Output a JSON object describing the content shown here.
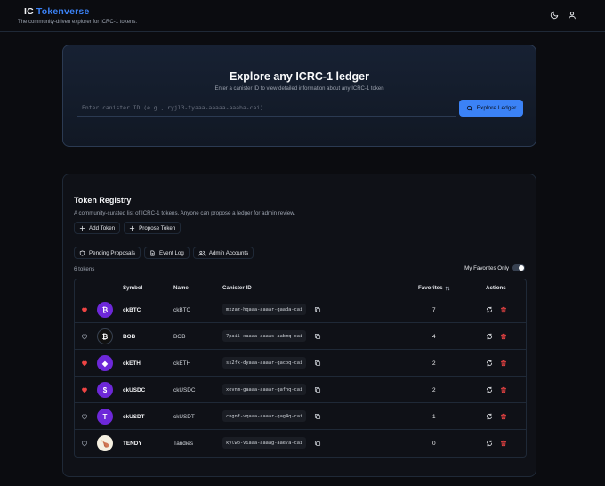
{
  "app": {
    "logo_ic": "IC",
    "logo_rest": "Tokenverse",
    "tagline": "The community-driven explorer for ICRC-1 tokens."
  },
  "header": {
    "theme_icon": "moon-icon",
    "user_icon": "user-icon"
  },
  "hero": {
    "title": "Explore any ICRC-1 ledger",
    "subtitle": "Enter a canister ID to view detailed information about any ICRC-1 token",
    "input_value": "",
    "input_placeholder": "Enter canister ID (e.g., ryjl3-tyaaa-aaaaa-aaaba-cai)",
    "button_label": "Explore Ledger",
    "accent_color": "#3b82f6"
  },
  "registry": {
    "title": "Token Registry",
    "subtitle": "A community-curated list of ICRC-1 tokens. Anyone can propose a ledger for admin review.",
    "add_token_label": "Add Token",
    "propose_token_label": "Propose Token",
    "pending_label": "Pending Proposals",
    "event_log_label": "Event Log",
    "admin_label": "Admin Accounts",
    "count_label": "6 tokens",
    "favorites_only_label": "My Favorites Only",
    "favorites_only_on": false
  },
  "table": {
    "columns": {
      "symbol": "Symbol",
      "name": "Name",
      "canister": "Canister ID",
      "favorites": "Favorites",
      "actions": "Actions"
    },
    "rows": [
      {
        "favorited": true,
        "icon": "bitcoin-icon",
        "icon_text": "₿",
        "icon_color": "#6d28d9",
        "symbol": "ckBTC",
        "name": "ckBTC",
        "canister": "mxzaz-hqaaa-aaaar-qaada-cai",
        "favorites": "7"
      },
      {
        "favorited": false,
        "icon": "bitcoin-icon",
        "icon_text": "₿",
        "icon_color": "#111111",
        "symbol": "BOB",
        "name": "BOB",
        "canister": "7pail-xaaaa-aaaas-aabmq-cai",
        "favorites": "4"
      },
      {
        "favorited": true,
        "icon": "ethereum-icon",
        "icon_text": "◆",
        "icon_color": "#6d28d9",
        "symbol": "ckETH",
        "name": "ckETH",
        "canister": "ss2fx-dyaaa-aaaar-qacoq-cai",
        "favorites": "2"
      },
      {
        "favorited": true,
        "icon": "usdc-icon",
        "icon_text": "$",
        "icon_color": "#6d28d9",
        "symbol": "ckUSDC",
        "name": "ckUSDC",
        "canister": "xevnm-gaaaa-aaaar-qafnq-cai",
        "favorites": "2"
      },
      {
        "favorited": false,
        "icon": "tether-icon",
        "icon_text": "T",
        "icon_color": "#6d28d9",
        "symbol": "ckUSDT",
        "name": "ckUSDT",
        "canister": "cngnf-vqaaa-aaaar-qag4q-cai",
        "favorites": "1"
      },
      {
        "favorited": false,
        "icon": "tendy-icon",
        "icon_text": "🍗",
        "icon_color": "#f5f0e1",
        "symbol": "TENDY",
        "name": "Tandies",
        "canister": "kylwo-viaaa-aaaag-aae7a-cai",
        "favorites": "0"
      }
    ]
  }
}
